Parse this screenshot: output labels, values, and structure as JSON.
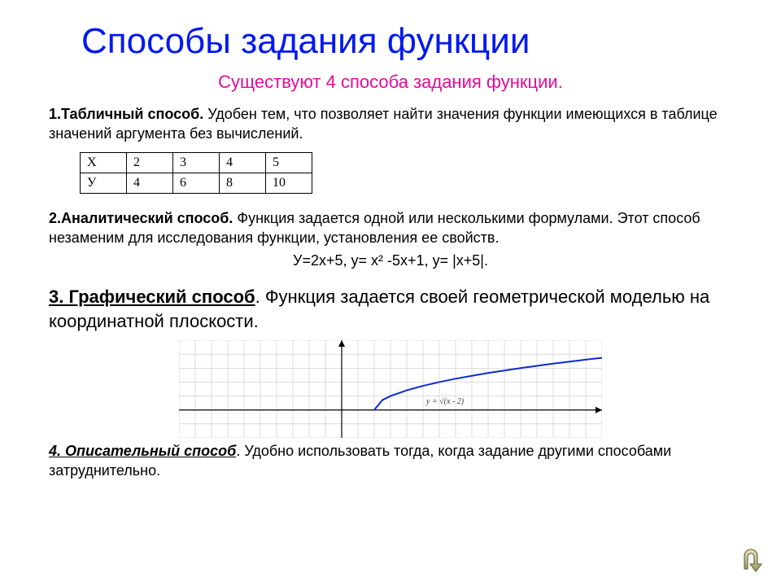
{
  "title": "Способы задания функции",
  "subtitle": "Существуют 4 способа задания функции.",
  "sections": {
    "s1": {
      "lead": "1.Табличный способ.",
      "rest": " Удобен тем, что позволяет найти значения функции имеющихся в таблице значений аргумента без вычислений."
    },
    "s2": {
      "lead": "2.Аналитический способ.",
      "rest": " Функция задается одной или несколькими формулами. Этот способ незаменим для исследования функции, установления ее свойств.",
      "formulas": "У=2х+5,   у= х² -5х+1,     у= |х+5|."
    },
    "s3": {
      "lead": "3. Графический способ",
      "rest": ". Функция задается своей геометрической моделью на координатной плоскости."
    },
    "s4": {
      "lead": " 4. Описательный способ",
      "after": ". Удобно использовать тогда, когда задание другими способами затруднительно."
    }
  },
  "table": {
    "headers": [
      "Х",
      "2",
      "3",
      "4",
      "5"
    ],
    "row2": [
      "У",
      "4",
      "6",
      "8",
      "10"
    ]
  },
  "chart_data": {
    "type": "line",
    "title": "",
    "xlabel": "",
    "ylabel": "",
    "xlim": [
      -10,
      16
    ],
    "ylim": [
      -2,
      5
    ],
    "annotation": "y = √(x - 2)",
    "series": [
      {
        "name": "y=√(x-2)",
        "x": [
          2,
          2.5,
          3,
          4,
          5,
          6,
          7,
          8,
          9,
          10,
          11,
          12,
          13,
          14,
          15,
          16
        ],
        "values": [
          0,
          0.71,
          1.0,
          1.41,
          1.73,
          2.0,
          2.24,
          2.45,
          2.65,
          2.83,
          3.0,
          3.16,
          3.32,
          3.46,
          3.61,
          3.74
        ]
      }
    ]
  },
  "nav": {
    "back_label": "Назад"
  }
}
